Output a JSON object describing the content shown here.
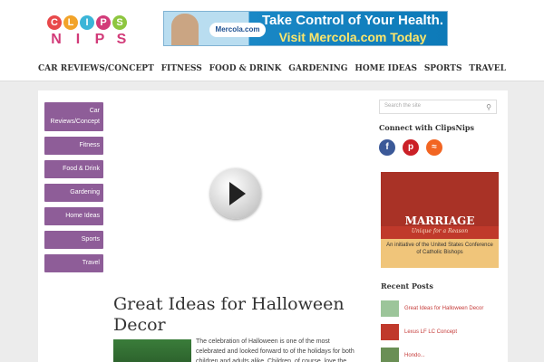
{
  "logo": {
    "line1": [
      "C",
      "L",
      "I",
      "P",
      "S"
    ],
    "line2": [
      "N",
      "I",
      "P",
      "S"
    ],
    "colors": [
      "#e8484a",
      "#f2a329",
      "#3bb5d8",
      "#d23b79",
      "#8dc63f"
    ]
  },
  "banner": {
    "brand": "Mercola.com",
    "line1": "Take Control of Your Health.",
    "line2": "Visit Mercola.com Today"
  },
  "nav": [
    "CAR REVIEWS/CONCEPT",
    "FITNESS",
    "FOOD & DRINK",
    "GARDENING",
    "HOME IDEAS",
    "SPORTS",
    "TRAVEL"
  ],
  "categories": [
    "Car Reviews/Concept",
    "Fitness",
    "Food & Drink",
    "Gardening",
    "Home Ideas",
    "Sports",
    "Travel"
  ],
  "post": {
    "title": "Great Ideas for Halloween Decor",
    "excerpt": "The celebration of Halloween is one of the most celebrated and looked forward to of the holidays for both children and adults alike. Children, of course, love the candy reward that is given to"
  },
  "sidebar": {
    "search_placeholder": "Search the site",
    "connect": "Connect with ClipsNips",
    "ad": {
      "title": "MARRIAGE",
      "subtitle": "Unique for a Reason",
      "initiative": "An initiative of the United States Conference of Catholic Bishops"
    },
    "recent_title": "Recent Posts",
    "recent": [
      "Great Ideas for Halloween Decor",
      "Lexus LF LC Concept",
      "Hondo..."
    ]
  }
}
